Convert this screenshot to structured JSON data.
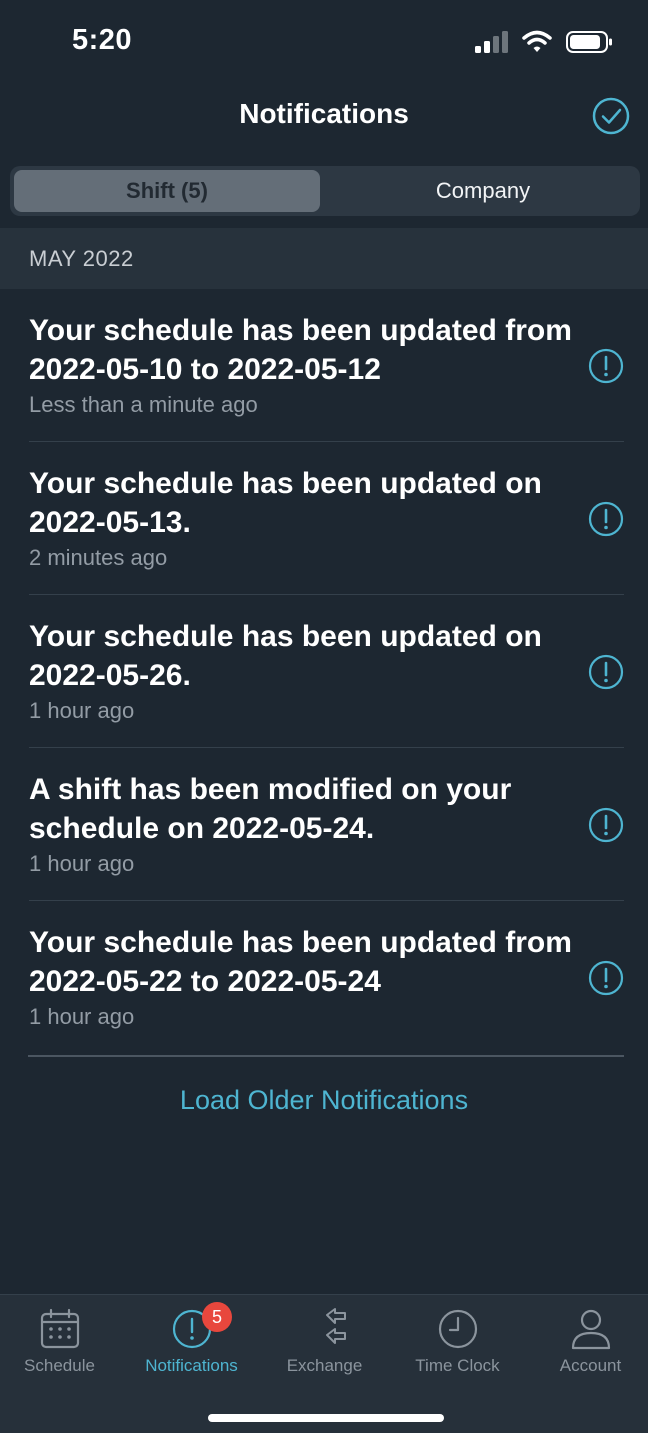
{
  "status_bar": {
    "time": "5:20"
  },
  "header": {
    "title": "Notifications"
  },
  "segments": {
    "shift": "Shift (5)",
    "company": "Company"
  },
  "section": {
    "label": "MAY 2022"
  },
  "notifications": [
    {
      "title": "Your schedule has been updated from 2022-05-10 to 2022-05-12",
      "time": "Less than a minute ago"
    },
    {
      "title": "Your schedule has been updated on 2022-05-13.",
      "time": "2 minutes ago"
    },
    {
      "title": "Your schedule has been updated on 2022-05-26.",
      "time": "1 hour ago"
    },
    {
      "title": "A shift has been modified on your schedule on 2022-05-24.",
      "time": "1 hour ago"
    },
    {
      "title": "Your schedule has been updated from 2022-05-22 to 2022-05-24",
      "time": "1 hour ago"
    }
  ],
  "load_older": "Load Older Notifications",
  "tabs": [
    {
      "label": "Schedule",
      "icon": "calendar-icon"
    },
    {
      "label": "Notifications",
      "icon": "alert-icon",
      "badge": "5"
    },
    {
      "label": "Exchange",
      "icon": "exchange-arrows-icon"
    },
    {
      "label": "Time Clock",
      "icon": "clock-icon"
    },
    {
      "label": "Account",
      "icon": "person-icon"
    }
  ],
  "colors": {
    "accent": "#4eb5d1",
    "background": "#1d2731",
    "badge": "#e8473d"
  }
}
